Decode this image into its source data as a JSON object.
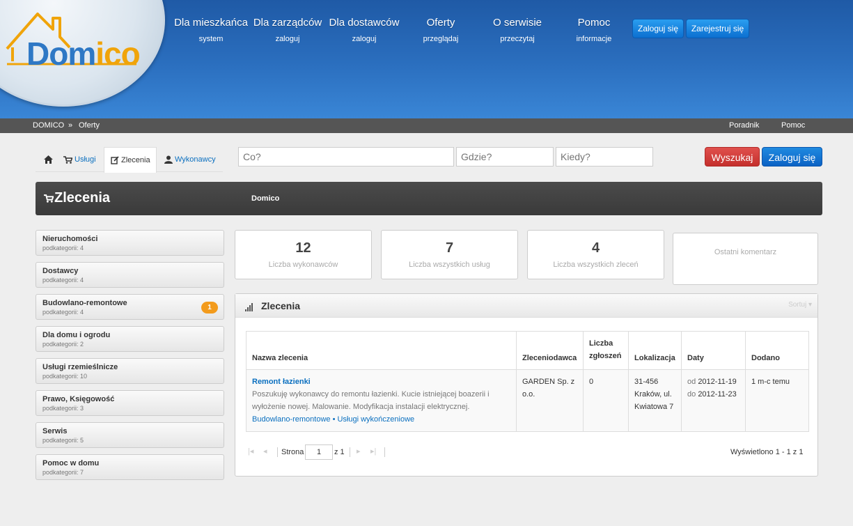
{
  "header": {
    "logo": {
      "part1": "Dom",
      "part2": "ico"
    },
    "nav": [
      {
        "title": "Dla mieszkańca",
        "sub": "system"
      },
      {
        "title": "Dla zarządców",
        "sub": "zaloguj"
      },
      {
        "title": "Dla dostawców",
        "sub": "zaloguj"
      },
      {
        "title": "Oferty",
        "sub": "przeglądaj"
      },
      {
        "title": "O serwisie",
        "sub": "przeczytaj"
      },
      {
        "title": "Pomoc",
        "sub": "informacje"
      }
    ],
    "login_label": "Zaloguj się",
    "register_label": "Zarejestruj się"
  },
  "breadcrumb": {
    "home": "DOMICO",
    "separator": "»",
    "current": "Oferty",
    "right_links": [
      "Poradnik",
      "Pomoc"
    ]
  },
  "tabs": [
    {
      "icon": "home-icon",
      "label": ""
    },
    {
      "icon": "cart-icon",
      "label": "Usługi"
    },
    {
      "icon": "edit-icon",
      "label": "Zlecenia"
    },
    {
      "icon": "user-icon",
      "label": "Wykonawcy"
    }
  ],
  "search": {
    "what_placeholder": "Co?",
    "where_placeholder": "Gdzie?",
    "when_placeholder": "Kiedy?",
    "search_label": "Wyszukaj",
    "login_label": "Zaloguj się"
  },
  "section_bar": {
    "title": "Zlecenia",
    "subtitle": "Domico"
  },
  "categories": [
    {
      "name": "Nieruchomości",
      "sub": "podkategorii: 4",
      "badge": ""
    },
    {
      "name": "Dostawcy",
      "sub": "podkategorii: 4",
      "badge": ""
    },
    {
      "name": "Budowlano-remontowe",
      "sub": "podkategorii: 4",
      "badge": "1"
    },
    {
      "name": "Dla domu i ogrodu",
      "sub": "podkategorii: 2",
      "badge": ""
    },
    {
      "name": "Usługi rzemieślnicze",
      "sub": "podkategorii: 10",
      "badge": ""
    },
    {
      "name": "Prawo, Księgowość",
      "sub": "podkategorii: 3",
      "badge": ""
    },
    {
      "name": "Serwis",
      "sub": "podkategorii: 5",
      "badge": ""
    },
    {
      "name": "Pomoc w domu",
      "sub": "podkategorii: 7",
      "badge": ""
    }
  ],
  "stats": [
    {
      "value": "12",
      "label": "Liczba wykonawców"
    },
    {
      "value": "7",
      "label": "Liczba wszystkich usług"
    },
    {
      "value": "4",
      "label": "Liczba wszystkich zleceń"
    },
    {
      "value": "",
      "label": "Ostatni komentarz"
    }
  ],
  "orders_panel": {
    "title": "Zlecenia",
    "sort_label": "Sortuj",
    "columns": [
      "Nazwa zlecenia",
      "Zleceniodawca",
      "Liczba zgłoszeń",
      "Lokalizacja",
      "Daty",
      "Dodano"
    ],
    "rows": [
      {
        "name": "Remont łazienki",
        "description": "Poszukuję wykonawcy do remontu łazienki. Kucie istniejącej boazerii i wyłożenie nowej. Malowanie. Modyfikacja instalacji elektrycznej.",
        "tags": "Budowlano-remontowe • Usługi wykończeniowe",
        "client": "GARDEN Sp. z o.o.",
        "submissions": "0",
        "location": "31-456 Kraków, ul. Kwiatowa 7",
        "date_from_label": "od",
        "date_from": "2012-11-19",
        "date_to_label": "do",
        "date_to": "2012-11-23",
        "added": "1 m-c temu"
      }
    ],
    "pager": {
      "page_label": "Strona",
      "page": "1",
      "of_label": "z 1",
      "summary": "Wyświetlono 1 - 1 z 1"
    }
  },
  "colors": {
    "header_blue": "#2b6fbf",
    "link_blue": "#0a6fbf",
    "badge_orange": "#f39b1c",
    "danger_red": "#d9403d"
  }
}
